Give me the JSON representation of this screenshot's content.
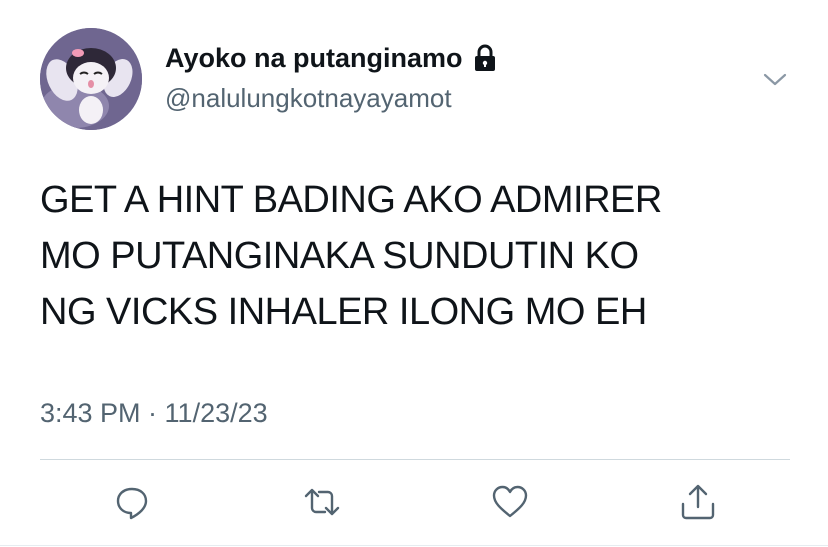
{
  "author": {
    "display_name": "Ayoko na putanginamo",
    "handle": "@nalulungkotnayayamot",
    "protected_icon": "lock-icon",
    "avatar_icon": "cartoon-character-avatar"
  },
  "tweet": {
    "lines": [
      "GET A HINT BADING AKO ADMIRER",
      "MO PUTANGINAKA SUNDUTIN KO",
      "NG VICKS INHALER ILONG MO EH"
    ],
    "timestamp": "3:43 PM · 11/23/23"
  },
  "actions": [
    "reply-icon",
    "retweet-icon",
    "like-icon",
    "share-icon"
  ],
  "menu_icon": "chevron-down-icon",
  "colors": {
    "text": "#0f1419",
    "secondary": "#536471",
    "divider": "#cfd9de"
  }
}
